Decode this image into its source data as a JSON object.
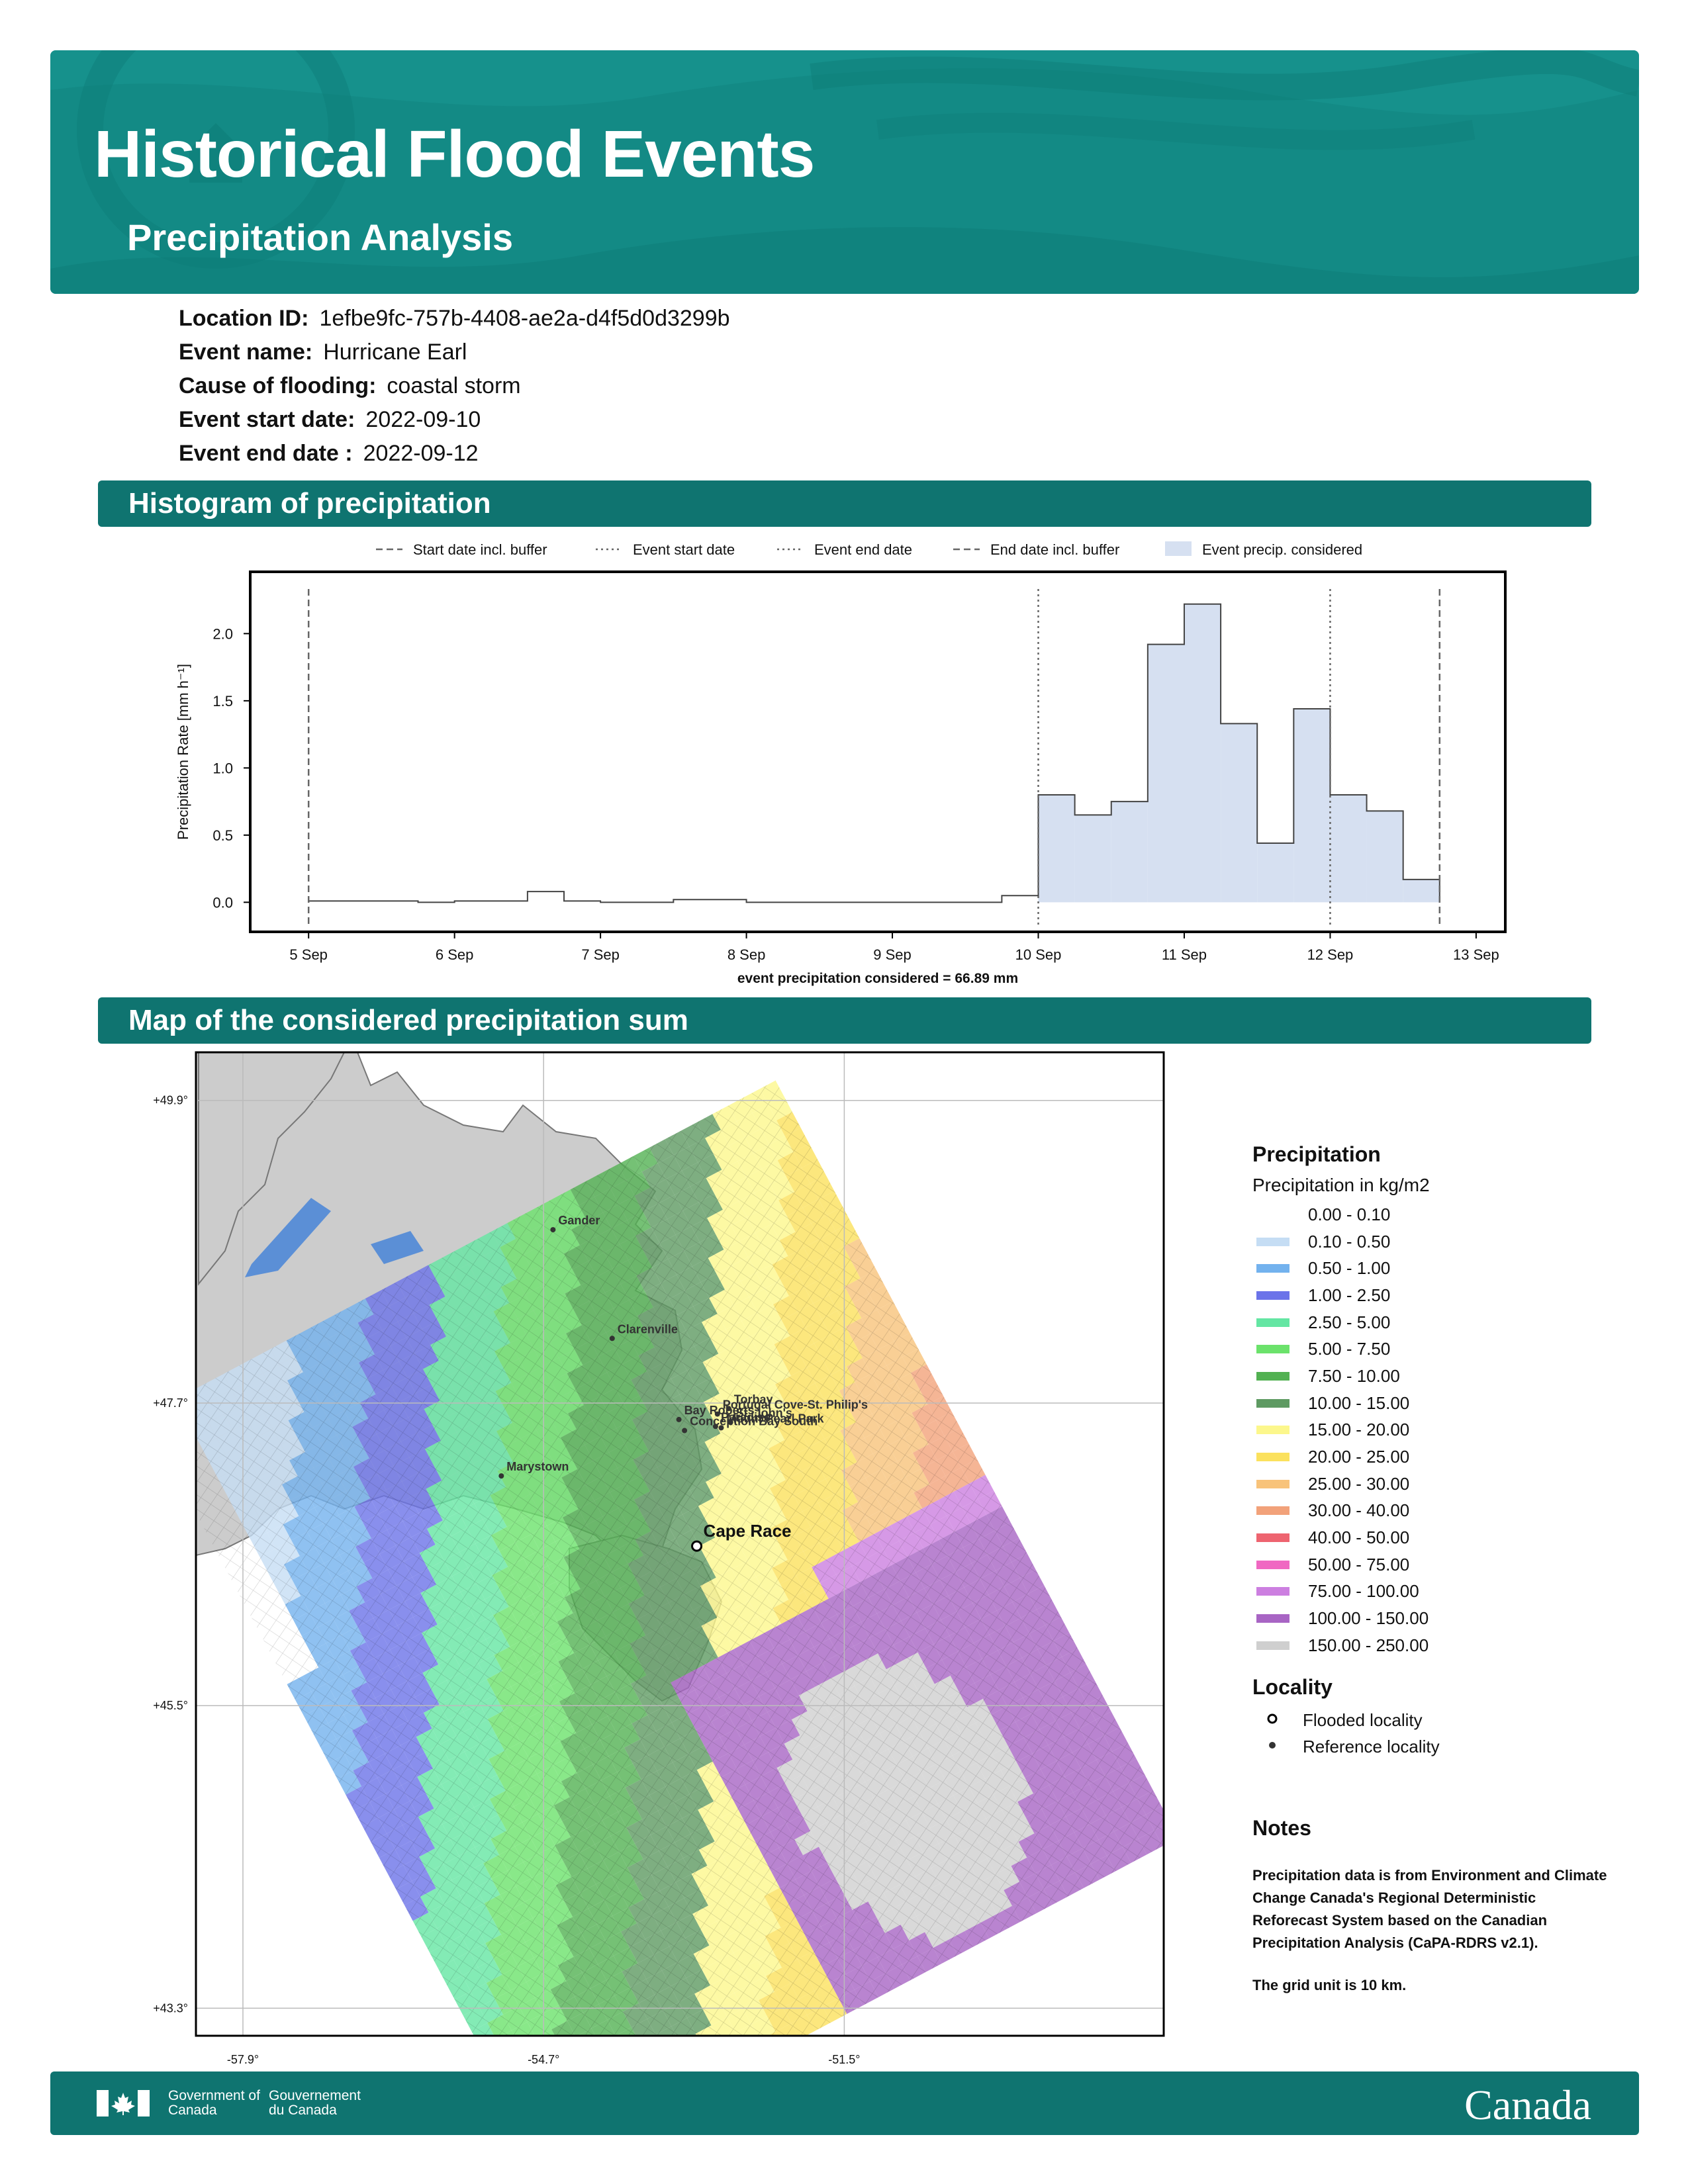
{
  "header": {
    "title": "Historical Flood Events",
    "subtitle": "Precipitation Analysis"
  },
  "event": {
    "fields": [
      {
        "key": "Location ID:",
        "value": "1efbe9fc-757b-4408-ae2a-d4f5d0d3299b"
      },
      {
        "key": "Event name:",
        "value": "Hurricane Earl"
      },
      {
        "key": "Cause of flooding:",
        "value": "coastal storm"
      },
      {
        "key": "Event start date:",
        "value": "2022-09-10"
      },
      {
        "key": "Event end date :",
        "value": "2022-09-12"
      }
    ]
  },
  "sections": {
    "histogram_title": "Histogram of precipitation",
    "map_title": "Map of the considered precipitation sum"
  },
  "chart_data": [
    {
      "type": "bar",
      "title": "",
      "ylabel": "Precipitation Rate [mm h⁻¹]",
      "xlabel": "event precipitation considered = 66.89 mm",
      "xlim_days": [
        4.6,
        13.2
      ],
      "ylim": [
        -0.22,
        2.46
      ],
      "yticks": [
        0.0,
        0.5,
        1.0,
        1.5,
        2.0
      ],
      "ytick_labels": [
        "0.0",
        "0.5",
        "1.0",
        "1.5",
        "2.0"
      ],
      "xticks": [
        5,
        6,
        7,
        8,
        9,
        10,
        11,
        12,
        13
      ],
      "xtick_labels": [
        "5 Sep",
        "6 Sep",
        "7 Sep",
        "8 Sep",
        "9 Sep",
        "10 Sep",
        "11 Sep",
        "12 Sep",
        "13 Sep"
      ],
      "series_step": [
        {
          "start": 5.0,
          "end": 5.75,
          "value": 0.01
        },
        {
          "start": 5.75,
          "end": 6.0,
          "value": 0.0
        },
        {
          "start": 6.0,
          "end": 6.5,
          "value": 0.01
        },
        {
          "start": 6.5,
          "end": 6.75,
          "value": 0.08
        },
        {
          "start": 6.75,
          "end": 7.0,
          "value": 0.01
        },
        {
          "start": 7.0,
          "end": 7.5,
          "value": 0.0
        },
        {
          "start": 7.5,
          "end": 8.0,
          "value": 0.02
        },
        {
          "start": 8.0,
          "end": 9.75,
          "value": 0.0
        },
        {
          "start": 9.75,
          "end": 10.0,
          "value": 0.05
        },
        {
          "start": 10.0,
          "end": 10.25,
          "value": 0.8,
          "considered": true
        },
        {
          "start": 10.25,
          "end": 10.5,
          "value": 0.65,
          "considered": true
        },
        {
          "start": 10.5,
          "end": 10.75,
          "value": 0.75,
          "considered": true
        },
        {
          "start": 10.75,
          "end": 11.0,
          "value": 1.92,
          "considered": true
        },
        {
          "start": 11.0,
          "end": 11.25,
          "value": 2.22,
          "considered": true
        },
        {
          "start": 11.25,
          "end": 11.5,
          "value": 1.33,
          "considered": true
        },
        {
          "start": 11.5,
          "end": 11.75,
          "value": 0.44,
          "considered": true
        },
        {
          "start": 11.75,
          "end": 12.0,
          "value": 1.44,
          "considered": true
        },
        {
          "start": 12.0,
          "end": 12.25,
          "value": 0.8,
          "considered": true
        },
        {
          "start": 12.25,
          "end": 12.5,
          "value": 0.68,
          "considered": true
        },
        {
          "start": 12.5,
          "end": 12.75,
          "value": 0.17,
          "considered": true
        }
      ],
      "vlines": [
        {
          "label": "Start date incl. buffer",
          "x": 5.0,
          "style": "dashed"
        },
        {
          "label": "Event start date",
          "x": 10.0,
          "style": "dotted"
        },
        {
          "label": "Event end date",
          "x": 12.0,
          "style": "dotted"
        },
        {
          "label": "End date incl. buffer",
          "x": 12.75,
          "style": "dashed"
        }
      ],
      "legend": [
        {
          "label": "Start date incl. buffer",
          "kind": "dashed"
        },
        {
          "label": "Event start date",
          "kind": "dotted"
        },
        {
          "label": "Event end date",
          "kind": "dotted"
        },
        {
          "label": "End date incl. buffer",
          "kind": "dashed"
        },
        {
          "label": "Event precip. considered",
          "kind": "fill"
        }
      ],
      "fill_color": "#d6e0f1",
      "legend_position": "top",
      "grid": false
    },
    {
      "type": "heatmap",
      "title": "",
      "x_tick_labels": [
        "-57.9°",
        "-54.7°",
        "-51.5°"
      ],
      "x_ticks": [
        -57.9,
        -54.7,
        -51.5
      ],
      "y_tick_labels": [
        "+49.9°",
        "+47.7°",
        "+45.5°",
        "+43.3°"
      ],
      "y_ticks": [
        49.9,
        47.7,
        45.5,
        43.3
      ],
      "lon_range": [
        -58.4,
        -48.1
      ],
      "lat_range": [
        43.1,
        50.25
      ],
      "grid": true,
      "grid_unit_km": 10,
      "colorbar_title": "Precipitation",
      "colorbar_subtitle": "Precipitation in kg/m2",
      "classes": [
        {
          "label": "0.00 - 0.10",
          "color": "#ffffff"
        },
        {
          "label": "0.10 - 0.50",
          "color": "#c5ddf4"
        },
        {
          "label": "0.50 - 1.00",
          "color": "#73b2ee"
        },
        {
          "label": "1.00 - 2.50",
          "color": "#6b73e9"
        },
        {
          "label": "2.50 - 5.00",
          "color": "#64e6a3"
        },
        {
          "label": "5.00 - 7.50",
          "color": "#6be26b"
        },
        {
          "label": "7.50 - 10.00",
          "color": "#52b152"
        },
        {
          "label": "10.00 - 15.00",
          "color": "#5e9a62"
        },
        {
          "label": "15.00 - 20.00",
          "color": "#fcf78c"
        },
        {
          "label": "20.00 - 25.00",
          "color": "#fbe15d"
        },
        {
          "label": "25.00 - 30.00",
          "color": "#f8c37a"
        },
        {
          "label": "30.00 - 40.00",
          "color": "#f2a27a"
        },
        {
          "label": "40.00 - 50.00",
          "color": "#ee6470"
        },
        {
          "label": "50.00 - 75.00",
          "color": "#f068c2"
        },
        {
          "label": "75.00 - 100.00",
          "color": "#cc7fe0"
        },
        {
          "label": "100.00 - 150.00",
          "color": "#a865c4"
        },
        {
          "label": "150.00 - 250.00",
          "color": "#cfcfcf"
        }
      ],
      "locality_title": "Locality",
      "localities_legend": [
        {
          "label": "Flooded locality",
          "marker": "open-circle"
        },
        {
          "label": "Reference locality",
          "marker": "dot"
        }
      ],
      "places": [
        {
          "name": "Gander",
          "lon": -54.6,
          "lat": 48.96,
          "kind": "reference"
        },
        {
          "name": "Clarenville",
          "lon": -53.97,
          "lat": 48.17,
          "kind": "reference"
        },
        {
          "name": "Portugal Cove-St. Philip's",
          "lon": -52.85,
          "lat": 47.62,
          "kind": "reference"
        },
        {
          "name": "Torbay",
          "lon": -52.73,
          "lat": 47.66,
          "kind": "reference"
        },
        {
          "name": "Paradise",
          "lon": -52.87,
          "lat": 47.53,
          "kind": "reference"
        },
        {
          "name": "Mount Pearl Park",
          "lon": -52.81,
          "lat": 47.52,
          "kind": "reference"
        },
        {
          "name": "St. John's",
          "lon": -52.71,
          "lat": 47.56,
          "kind": "reference"
        },
        {
          "name": "Bay Roberts",
          "lon": -53.26,
          "lat": 47.58,
          "kind": "reference"
        },
        {
          "name": "Conception Bay South",
          "lon": -53.2,
          "lat": 47.5,
          "kind": "reference"
        },
        {
          "name": "Marystown",
          "lon": -55.15,
          "lat": 47.17,
          "kind": "reference"
        },
        {
          "name": "Cape Race",
          "lon": -53.07,
          "lat": 46.66,
          "kind": "flooded"
        }
      ]
    }
  ],
  "notes": {
    "title": "Notes",
    "text": "Precipitation data is from Environment and Climate Change Canada's Regional Deterministic Reforecast System based on the Canadian Precipitation Analysis (CaPA-RDRS v2.1).",
    "grid_text": "The grid unit is 10 km."
  },
  "footer": {
    "gov_en": "Government of Canada",
    "gov_fr": "Gouvernement du Canada",
    "wordmark": "Canada"
  },
  "colors": {
    "banner": "#138a85",
    "section_bar": "#0f7470",
    "land": "#cccccc"
  }
}
